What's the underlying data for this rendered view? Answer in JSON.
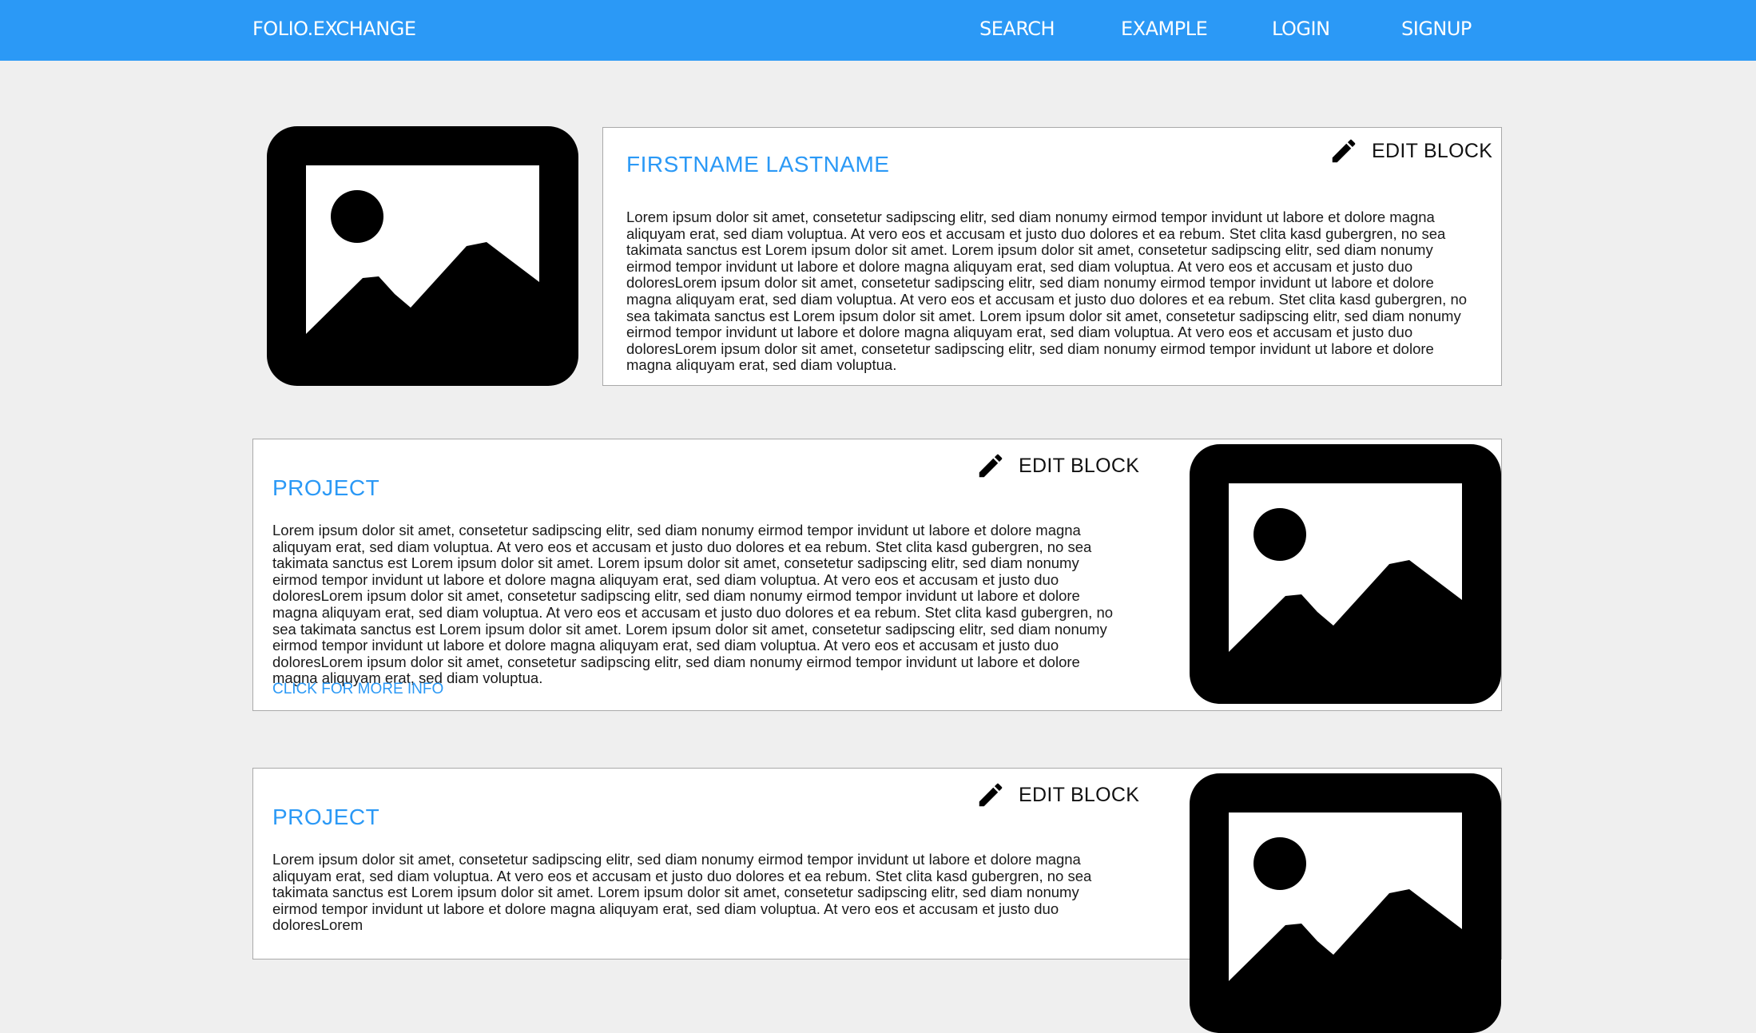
{
  "header": {
    "brand": "FOLIO.EXCHANGE",
    "nav": [
      "SEARCH",
      "EXAMPLE",
      "LOGIN",
      "SIGNUP"
    ]
  },
  "profile": {
    "name": "FIRSTNAME LASTNAME",
    "edit_label": "EDIT BLOCK",
    "bio": "Lorem ipsum dolor sit amet, consetetur sadipscing elitr, sed diam nonumy eirmod tempor invidunt ut labore et dolore magna aliquyam erat, sed diam voluptua. At vero eos et accusam et justo duo dolores et ea rebum. Stet clita kasd gubergren, no sea takimata sanctus est Lorem ipsum dolor sit amet. Lorem ipsum dolor sit amet, consetetur sadipscing elitr, sed diam nonumy eirmod tempor invidunt ut labore et dolore magna aliquyam erat, sed diam voluptua. At vero eos et accusam et justo duo doloresLorem ipsum dolor sit amet, consetetur sadipscing elitr, sed diam nonumy eirmod tempor invidunt ut labore et dolore magna aliquyam erat, sed diam voluptua. At vero eos et accusam et justo duo dolores et ea rebum. Stet clita kasd gubergren, no sea takimata sanctus est Lorem ipsum dolor sit amet. Lorem ipsum dolor sit amet, consetetur sadipscing elitr, sed diam nonumy eirmod tempor invidunt ut labore et dolore magna aliquyam erat, sed diam voluptua. At vero eos et accusam et justo duo doloresLorem ipsum dolor sit amet, consetetur sadipscing elitr, sed diam nonumy eirmod tempor invidunt ut labore et dolore magna aliquyam erat, sed diam voluptua."
  },
  "projects": [
    {
      "title": "PROJECT",
      "edit_label": "EDIT BLOCK",
      "body": "Lorem ipsum dolor sit amet, consetetur sadipscing elitr, sed diam nonumy eirmod tempor invidunt ut labore et dolore magna aliquyam erat, sed diam voluptua. At vero eos et accusam et justo duo dolores et ea rebum. Stet clita kasd gubergren, no sea takimata sanctus est Lorem ipsum dolor sit amet. Lorem ipsum dolor sit amet, consetetur sadipscing elitr, sed diam nonumy eirmod tempor invidunt ut labore et dolore magna aliquyam erat, sed diam voluptua. At vero eos et accusam et justo duo doloresLorem ipsum dolor sit amet, consetetur sadipscing elitr, sed diam nonumy eirmod tempor invidunt ut labore et dolore magna aliquyam erat, sed diam voluptua. At vero eos et accusam et justo duo dolores et ea rebum. Stet clita kasd gubergren, no sea takimata sanctus est Lorem ipsum dolor sit amet. Lorem ipsum dolor sit amet, consetetur sadipscing elitr, sed diam nonumy eirmod tempor invidunt ut labore et dolore magna aliquyam erat, sed diam voluptua. At vero eos et accusam et justo duo doloresLorem ipsum dolor sit amet, consetetur sadipscing elitr, sed diam nonumy eirmod tempor invidunt ut labore et dolore magna aliquyam erat, sed diam voluptua.",
      "more_label": "CLICK FOR MORE INFO"
    },
    {
      "title": "PROJECT",
      "edit_label": "EDIT BLOCK",
      "body": "Lorem ipsum dolor sit amet, consetetur sadipscing elitr, sed diam nonumy eirmod tempor invidunt ut labore et dolore magna aliquyam erat, sed diam voluptua. At vero eos et accusam et justo duo dolores et ea rebum. Stet clita kasd gubergren, no sea takimata sanctus est Lorem ipsum dolor sit amet. Lorem ipsum dolor sit amet, consetetur sadipscing elitr, sed diam nonumy eirmod tempor invidunt ut labore et dolore magna aliquyam erat, sed diam voluptua. At vero eos et accusam et justo duo doloresLorem"
    }
  ],
  "icons": {
    "edit": "pencil-icon",
    "image": "image-placeholder-icon"
  },
  "colors": {
    "accent": "#2b99f6",
    "background": "#efefef"
  }
}
